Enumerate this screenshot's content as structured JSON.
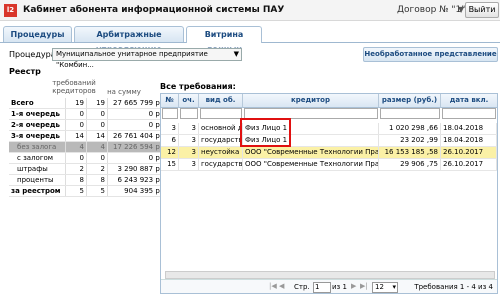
{
  "header": {
    "logo": "l2",
    "title": "Кабинет абонента информационной системы ПАУ",
    "contract": "Договор № \"1\"",
    "exit_label": "Выйти"
  },
  "tabs": [
    {
      "label": "Процедуры"
    },
    {
      "label": "Арбитражные управляющие"
    },
    {
      "label": "Витрина данных"
    }
  ],
  "procedure": {
    "label": "Процедура:",
    "value": "Муниципальное унитарное предприятие \"Комбин..."
  },
  "unprocessed_button": "Необработанное представление",
  "registry": {
    "title": "Реестр",
    "col_creditors": "требований кредиторов",
    "col_sum": "на сумму",
    "rows": [
      {
        "name": "Всего",
        "a": "19",
        "b": "19",
        "sum": "27 665 799 р."
      },
      {
        "name": "1-я очередь",
        "a": "0",
        "b": "0",
        "sum": "0 р."
      },
      {
        "name": "2-я очередь",
        "a": "0",
        "b": "0",
        "sum": "0 р."
      },
      {
        "name": "3-я очередь",
        "a": "14",
        "b": "14",
        "sum": "26 761 404 р."
      },
      {
        "name": "без залога",
        "a": "4",
        "b": "4",
        "sum": "17 226 594 р."
      },
      {
        "name": "с залогом",
        "a": "0",
        "b": "0",
        "sum": "0 р."
      },
      {
        "name": "штрафы",
        "a": "2",
        "b": "2",
        "sum": "3 290 887 р."
      },
      {
        "name": "проценты",
        "a": "8",
        "b": "8",
        "sum": "6 243 923 р."
      },
      {
        "name": "за реестром",
        "a": "5",
        "b": "5",
        "sum": "904 395 р."
      }
    ]
  },
  "requirements": {
    "title": "Все требования:",
    "headers": {
      "num": "№",
      "queue": "оч.",
      "type": "вид об.",
      "creditor": "кредитор",
      "size": "размер (руб.)",
      "date": "дата вкл."
    },
    "rows": [
      {
        "num": "3",
        "queue": "3",
        "type": "основной д",
        "creditor": "Физ Лицо 1",
        "size": "1 020 298 ,66",
        "date": "18.04.2018"
      },
      {
        "num": "6",
        "queue": "3",
        "type": "государств",
        "creditor": "Физ Лицо 1",
        "size": "23 202 ,99",
        "date": "18.04.2018"
      },
      {
        "num": "12",
        "queue": "3",
        "type": "неустойка",
        "creditor": "ООО \"Современные Технологии Прав",
        "size": "16 153 185 ,58",
        "date": "26.10.2017"
      },
      {
        "num": "15",
        "queue": "3",
        "type": "государств",
        "creditor": "ООО \"Современные Технологии Прав",
        "size": "29 906 ,75",
        "date": "26.10.2017"
      }
    ],
    "pager": {
      "page_label": "Стр.",
      "page": "1",
      "of": "из 1",
      "per_page": "12",
      "summary": "Требования 1 - 4 из 4"
    }
  },
  "colors": {
    "accent": "#1c4b80",
    "highlight_row": "#fbf1a6",
    "annotation": "#e01010"
  }
}
